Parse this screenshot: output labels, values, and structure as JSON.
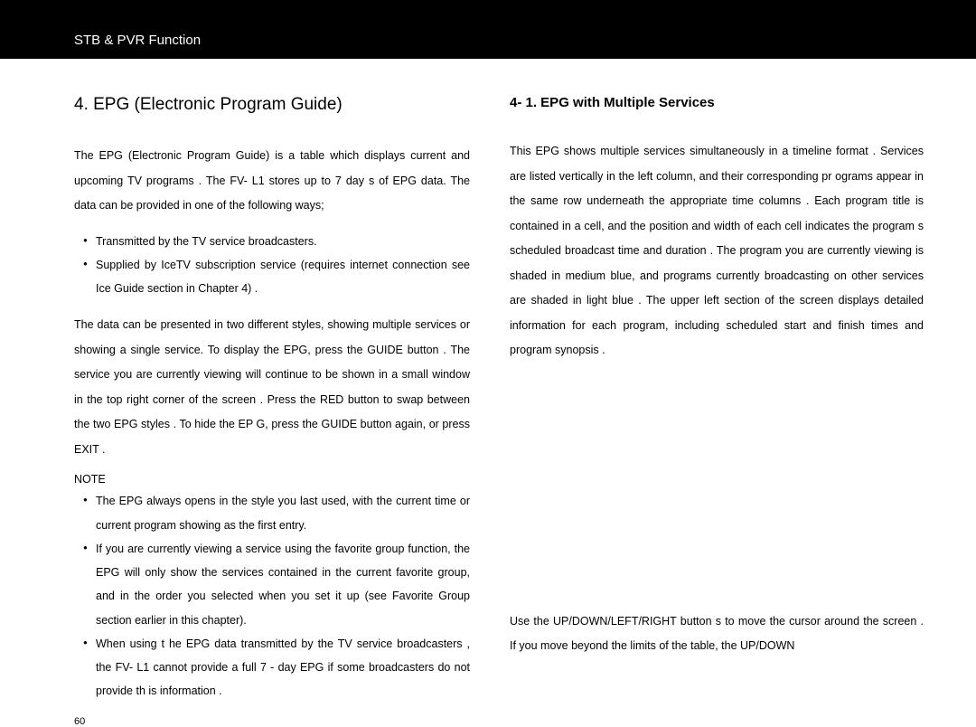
{
  "header": {
    "title": "STB & PVR Function"
  },
  "left": {
    "main_title": "4.  EPG  (Electronic Program Guide)",
    "intro": "The  EPG  (Electronic  Program  Guide)  is  a      table  which  displays  current and  upcoming  TV  programs    .    The  FV- L1  stores  up  to  7     day s  of  EPG data.    The data can be provided in one of the following ways;",
    "bullets1": [
      "Transmitted    by the TV service broadcasters.",
      "Supplied   by IceTV subscription service (requires internet connection    see  Ice Guide  section in Chapter 4)       ."
    ],
    "para2": "The  data  can  be  presented  in  two  different  styles,  showing  multiple services  or  showing  a     single  service.      To  display  the  EPG,  press     the GUIDE   button .   The service you are currently viewing will continue to be shown in a small window in the top right corner of the screen           .   Press the  RED  button   to swap   between   the  two  EPG styles .   To hide  the EP G, press  the  GUIDE   button again, or press      EXIT .",
    "note_label": "NOTE",
    "bullets2": [
      "The  EPG  always  opens  in  the  style  you  last  used,  with  the  current time or current program showing as the first entry.",
      "If  you  are  currently  viewing  a  service  using  the  favorite  group function, the EPG will only show the services contained in the current favorite group, and in the order you selected when you set it up (see  Favorite Group  section earlier in this chapter).",
      "When using t   he EPG data transmitted      by  the  TV service  broadcasters  , the  FV- L1  cannot   provide   a  full  7  - day  EPG  if  some  broadcasters  do not provide th   is information  ."
    ],
    "page_number": "60"
  },
  "right": {
    "sub_title": "4- 1.  EPG with Multiple Services",
    "para1": "This  EPG  shows    multiple    services   simultaneously  in  a  timeline  format       . Services are listed vertically in the left column, and their corresponding pr ograms  appear  in  the  same  row  underneath  the  appropriate  time columns .   Each program title is contained in a cell, and the position and width of each cell indicates the program s scheduled broadcast time and duration  .    The program you are currently viewing         is shaded in medium blue, and programs currently broadcasting on other services are shaded in  light  blue   .    The  upper  left  section  of  the  screen  displays  detailed information for each program, including scheduled start and finish times and program synopsis    .",
    "para2": "Use  the  UP/DOWN/LEFT/RIGHT        button  s  to  move  the  cursor  around the screen  .   If you move beyond the limits of the table,          the  UP/DOWN"
  }
}
